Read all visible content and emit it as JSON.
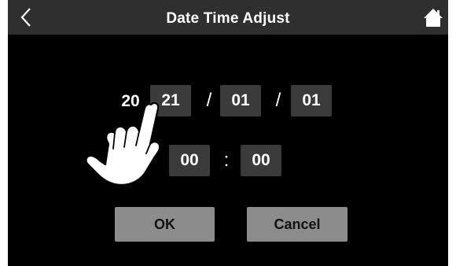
{
  "header": {
    "title": "Date Time Adjust",
    "back_icon": "chevron-left-icon",
    "home_icon": "home-icon"
  },
  "date": {
    "century": "20",
    "year": "21",
    "separator": "/",
    "month": "01",
    "day": "01"
  },
  "time": {
    "hour": "00",
    "separator": ":",
    "minute": "00"
  },
  "actions": {
    "ok_label": "OK",
    "cancel_label": "Cancel"
  },
  "overlay": {
    "gesture_icon": "tap-hand-icon"
  },
  "colors": {
    "background": "#000000",
    "titlebar": "#2f2f2f",
    "field": "#3b3b3b",
    "button": "#8c8c8c",
    "text": "#ffffff"
  }
}
